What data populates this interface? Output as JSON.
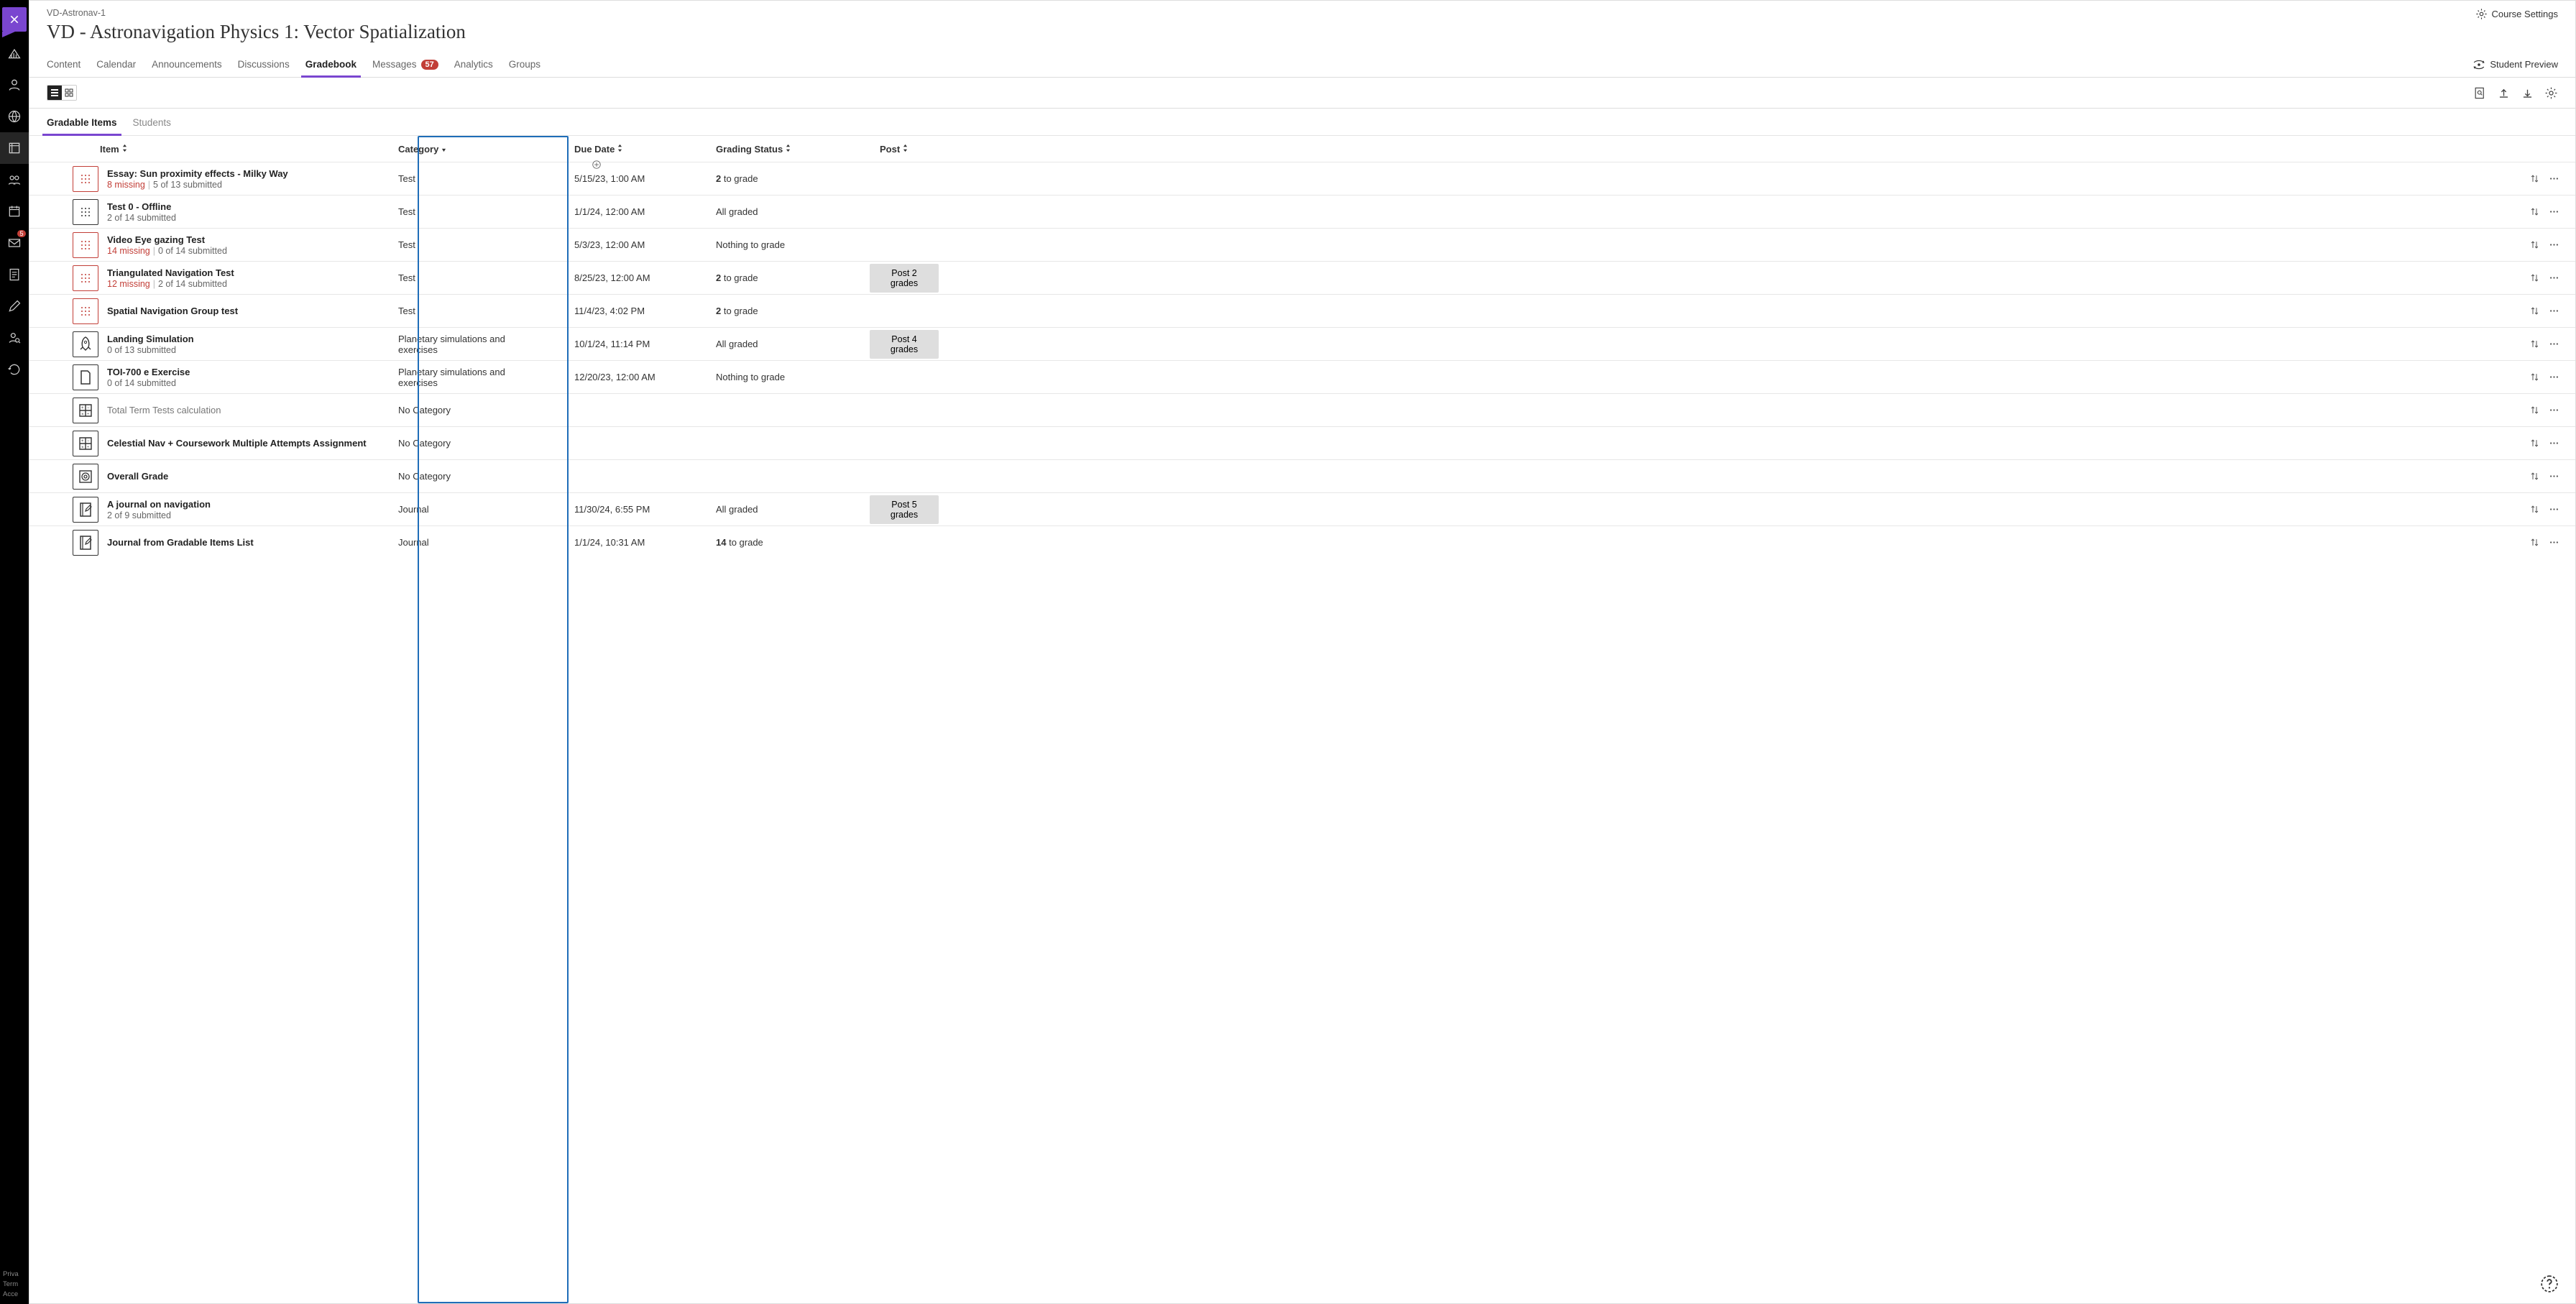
{
  "breadcrumb": "VD-Astronav-1",
  "course_title": "VD - Astronavigation Physics 1: Vector Spatialization",
  "course_settings_label": "Course Settings",
  "student_preview_label": "Student Preview",
  "tabs": {
    "content": "Content",
    "calendar": "Calendar",
    "announcements": "Announcements",
    "discussions": "Discussions",
    "gradebook": "Gradebook",
    "messages": "Messages",
    "messages_count": "57",
    "analytics": "Analytics",
    "groups": "Groups"
  },
  "subtabs": {
    "gradable": "Gradable Items",
    "students": "Students"
  },
  "columns": {
    "item": "Item",
    "category": "Category",
    "due": "Due Date",
    "status": "Grading Status",
    "post": "Post"
  },
  "priv": {
    "a": "Priva",
    "b": "Term",
    "c": "Acce"
  },
  "rows": [
    {
      "icon": "test",
      "alert": true,
      "title": "Essay: Sun proximity effects - Milky Way",
      "missing": "8 missing",
      "sub2": "5 of 13 submitted",
      "category": "Test",
      "due": "5/15/23, 1:00 AM",
      "status_n": "2",
      "status_t": " to grade",
      "post": ""
    },
    {
      "icon": "test",
      "alert": false,
      "title": "Test 0 - Offline",
      "missing": "",
      "sub2": "2 of 14 submitted",
      "category": "Test",
      "due": "1/1/24, 12:00 AM",
      "status_n": "",
      "status_t": "All graded",
      "post": ""
    },
    {
      "icon": "test",
      "alert": true,
      "title": "Video Eye gazing Test",
      "missing": "14 missing",
      "sub2": "0 of 14 submitted",
      "category": "Test",
      "due": "5/3/23, 12:00 AM",
      "status_n": "",
      "status_t": "Nothing to grade",
      "post": ""
    },
    {
      "icon": "test",
      "alert": true,
      "title": "Triangulated Navigation Test",
      "missing": "12 missing",
      "sub2": "2 of 14 submitted",
      "category": "Test",
      "due": "8/25/23, 12:00 AM",
      "status_n": "2",
      "status_t": " to grade",
      "post": "Post 2 grades"
    },
    {
      "icon": "test",
      "alert": true,
      "title": "Spatial Navigation Group test",
      "missing": "",
      "sub2": "",
      "category": "Test",
      "due": "11/4/23, 4:02 PM",
      "status_n": "2",
      "status_t": " to grade",
      "post": ""
    },
    {
      "icon": "rocket",
      "alert": false,
      "title": "Landing Simulation",
      "missing": "",
      "sub2": "0 of 13 submitted",
      "category": "Planetary simulations and exercises",
      "due": "10/1/24, 11:14 PM",
      "status_n": "",
      "status_t": "All graded",
      "post": "Post 4 grades"
    },
    {
      "icon": "doc",
      "alert": false,
      "title": "TOI-700 e Exercise",
      "missing": "",
      "sub2": "0 of 14 submitted",
      "category": "Planetary simulations and exercises",
      "due": "12/20/23, 12:00 AM",
      "status_n": "",
      "status_t": "Nothing to grade",
      "post": ""
    },
    {
      "icon": "calc",
      "alert": false,
      "title": "Total Term Tests calculation",
      "missing": "",
      "sub2": "",
      "category": "No Category",
      "due": "",
      "status_n": "",
      "status_t": "",
      "post": "",
      "gray_title": true
    },
    {
      "icon": "calc",
      "alert": false,
      "title": "Celestial Nav + Coursework Multiple Attempts Assignment",
      "missing": "",
      "sub2": "",
      "category": "No Category",
      "due": "",
      "status_n": "",
      "status_t": "",
      "post": ""
    },
    {
      "icon": "target",
      "alert": false,
      "title": "Overall Grade",
      "missing": "",
      "sub2": "",
      "category": "No Category",
      "due": "",
      "status_n": "",
      "status_t": "",
      "post": ""
    },
    {
      "icon": "journal",
      "alert": false,
      "title": "A journal on navigation",
      "missing": "",
      "sub2": "2 of 9 submitted",
      "category": "Journal",
      "due": "11/30/24, 6:55 PM",
      "status_n": "",
      "status_t": "All graded",
      "post": "Post 5 grades"
    },
    {
      "icon": "journal",
      "alert": false,
      "title": "Journal from Gradable Items List",
      "missing": "",
      "sub2": "",
      "category": "Journal",
      "due": "1/1/24, 10:31 AM",
      "status_n": "14",
      "status_t": " to grade",
      "post": ""
    }
  ]
}
